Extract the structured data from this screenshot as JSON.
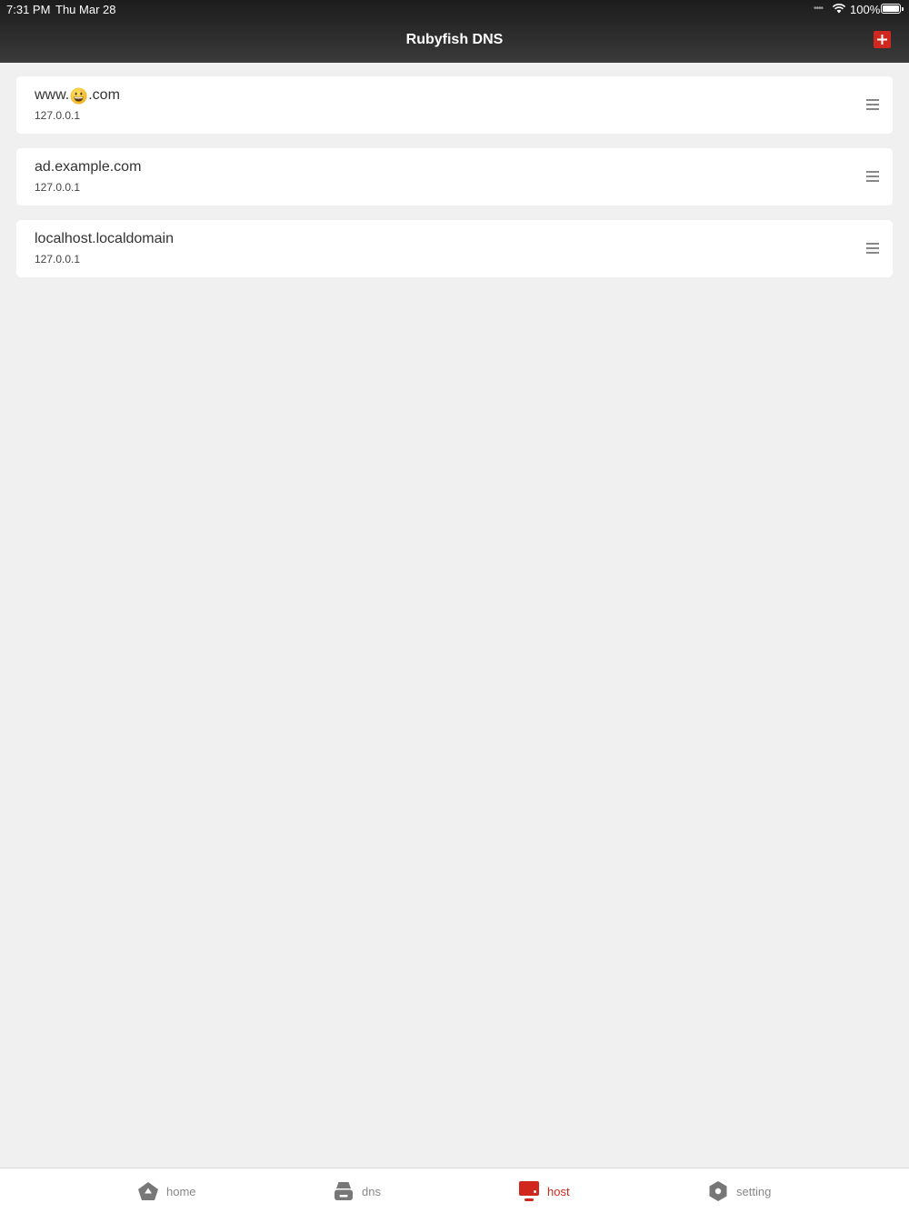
{
  "status_bar": {
    "time": "7:31 PM",
    "date": "Thu Mar 28",
    "signal": "••••",
    "battery": "100%"
  },
  "header": {
    "title": "Rubyfish DNS",
    "add_icon": "plus-icon",
    "accent_color": "#d0281e"
  },
  "hosts": [
    {
      "domain_prefix": "www.",
      "domain_emoji": "grinning-face-emoji",
      "domain_suffix": ".com",
      "ip": "127.0.0.1"
    },
    {
      "domain": "ad.example.com",
      "ip": "127.0.0.1"
    },
    {
      "domain": "localhost.localdomain",
      "ip": "127.0.0.1"
    }
  ],
  "tabs": [
    {
      "label": "home",
      "icon": "home-icon"
    },
    {
      "label": "dns",
      "icon": "server-icon"
    },
    {
      "label": "host",
      "icon": "monitor-icon",
      "active": true
    },
    {
      "label": "setting",
      "icon": "gear-icon"
    }
  ]
}
